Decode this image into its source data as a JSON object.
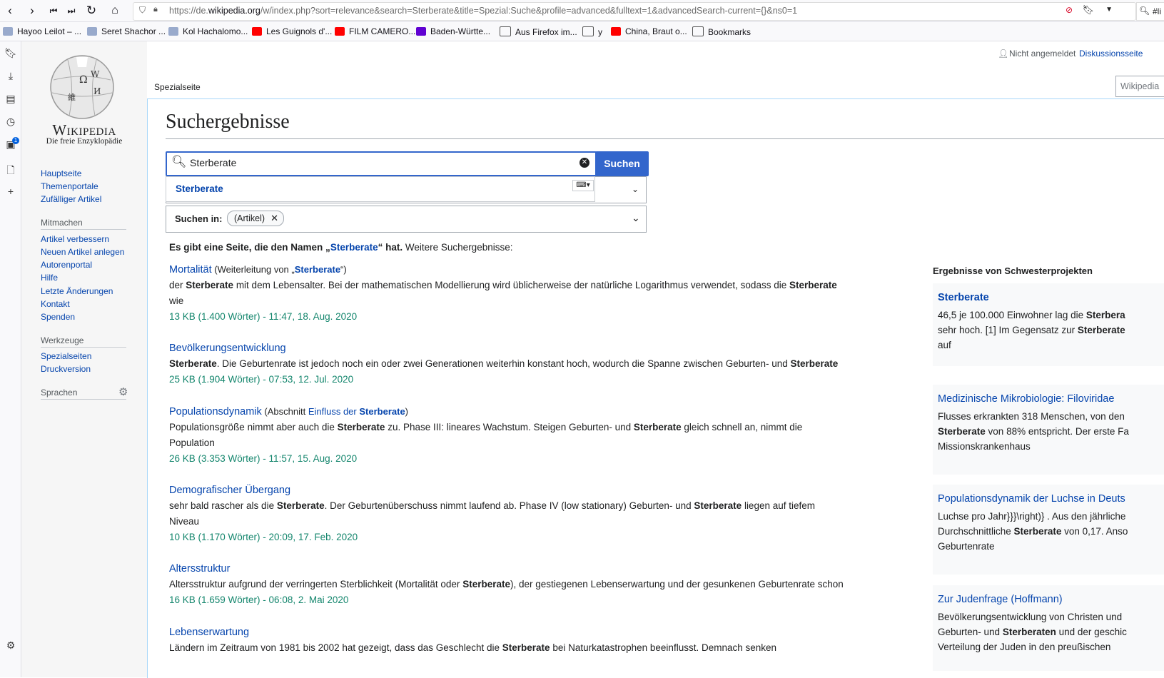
{
  "browser": {
    "url_prefix": "https://de.",
    "url_domain": "wikipedia.org",
    "url_rest": "/w/index.php?sort=relevance&search=Sterberate&title=Spezial:Suche&profile=advanced&fulltext=1&advancedSearch-current={}&ns0=1",
    "search_snippet": "#li",
    "bookmarks": [
      "Hayoo Leilot – ...",
      "Seret Shachor ...",
      "Kol Hachalomo...",
      "Les Guignols d'...",
      "FILM CAMERO...",
      "Baden-Württe...",
      "Aus Firefox im...",
      "y",
      "China, Braut o...",
      "Bookmarks"
    ],
    "sidebar_badge": "1"
  },
  "wiki": {
    "logo_word": "Wikipedia",
    "tagline": "Die freie Enzyklopädie",
    "personal": {
      "not_logged_in": "Nicht angemeldet",
      "talk": "Diskussionsseite"
    },
    "tab": "Spezialseite",
    "search_box_placeholder": "Wikipedia",
    "nav": [
      "Hauptseite",
      "Themenportale",
      "Zufälliger Artikel"
    ],
    "mitmachen_heading": "Mitmachen",
    "mitmachen": [
      "Artikel verbessern",
      "Neuen Artikel anlegen",
      "Autorenportal",
      "Hilfe",
      "Letzte Änderungen",
      "Kontakt",
      "Spenden"
    ],
    "werkzeuge_heading": "Werkzeuge",
    "werkzeuge": [
      "Spezialseiten",
      "Druckversion"
    ],
    "sprachen_heading": "Sprachen"
  },
  "search": {
    "heading": "Suchergebnisse",
    "query": "Sterberate",
    "button": "Suchen",
    "suggestion": "Sterberate",
    "search_in_label": "Suchen in:",
    "search_in_chip": "(Artikel)",
    "exact_pre": "Es gibt eine Seite, die den Namen „",
    "exact_term": "Sterberate",
    "exact_post": "“ hat.",
    "further": "Weitere Suchergebnisse:"
  },
  "results": [
    {
      "title": "Mortalität",
      "extra_pre": "(Weiterleitung von „",
      "extra_link": "Sterberate",
      "extra_post": "“)",
      "snippet_html": "der <b>Sterberate</b> mit dem Lebensalter. Bei der mathematischen Modellierung wird üblicherweise der natürliche Logarithmus verwendet, sodass die <b>Sterberate</b> wie",
      "meta": "13 KB (1.400 Wörter) - 11:47, 18. Aug. 2020"
    },
    {
      "title": "Bevölkerungsentwicklung",
      "extra_pre": "",
      "extra_link": "",
      "extra_post": "",
      "snippet_html": "<b>Sterberate</b>. Die Geburtenrate ist jedoch noch ein oder zwei Generationen weiterhin konstant hoch, wodurch die Spanne zwischen Geburten- und <b>Sterberate</b>",
      "meta": "25 KB (1.904 Wörter) - 07:53, 12. Jul. 2020"
    },
    {
      "title": "Populationsdynamik",
      "extra_pre": "(Abschnitt ",
      "extra_link": "Einfluss der Sterberate",
      "extra_post": ")",
      "snippet_html": "Populationsgröße nimmt aber auch die <b>Sterberate</b> zu. Phase III: lineares Wachstum. Steigen Geburten- und <b>Sterberate</b> gleich schnell an, nimmt die Population",
      "meta": "26 KB (3.353 Wörter) - 11:57, 15. Aug. 2020"
    },
    {
      "title": "Demografischer Übergang",
      "extra_pre": "",
      "extra_link": "",
      "extra_post": "",
      "snippet_html": "sehr bald rascher als die <b>Sterberate</b>. Der Geburtenüberschuss nimmt laufend ab. Phase IV (low stationary) Geburten- und <b>Sterberate</b> liegen auf tiefem Niveau",
      "meta": "10 KB (1.170 Wörter) - 20:09, 17. Feb. 2020"
    },
    {
      "title": "Altersstruktur",
      "extra_pre": "",
      "extra_link": "",
      "extra_post": "",
      "snippet_html": "Altersstruktur aufgrund der verringerten Sterblichkeit (Mortalität oder <b>Sterberate</b>), der gestiegenen Lebenserwartung und der gesunkenen Geburtenrate schon",
      "meta": "16 KB (1.659 Wörter) - 06:08, 2. Mai 2020"
    },
    {
      "title": "Lebenserwartung",
      "extra_pre": "",
      "extra_link": "",
      "extra_post": "",
      "snippet_html": "Ländern im Zeitraum von 1981 bis 2002 hat gezeigt, dass das Geschlecht die <b>Sterberate</b> bei Naturkatastrophen beeinflusst. Demnach senken",
      "meta": ""
    }
  ],
  "sister": {
    "heading": "Ergebnisse von Schwesterprojekten",
    "items": [
      {
        "title": "Sterberate",
        "snippet_html": "46,5 je 100.000 Einwohner lag die <b>Sterbera</b><br>sehr hoch. [1] Im Gegensatz zur <b>Sterberate</b><br>auf"
      },
      {
        "title": "Medizinische Mikrobiologie: Filoviridae",
        "snippet_html": "Flusses erkrankten 318 Menschen, von den<br><b>Sterberate</b> von 88% entspricht. Der erste Fa<br>Missionskrankenhaus"
      },
      {
        "title": "Populationsdynamik der Luchse in Deuts",
        "snippet_html": "Luchse pro Jahr}}}\\right)} . Aus den jährliche<br>Durchschnittliche <b>Sterberate</b> von 0,17. Anso<br>Geburtenrate"
      },
      {
        "title": "Zur Judenfrage (Hoffmann)",
        "snippet_html": "Bevölkerungsentwicklung von Christen und<br>Geburten- und <b>Sterberaten</b> und der geschic<br>Verteilung der Juden in den preußischen"
      }
    ]
  }
}
